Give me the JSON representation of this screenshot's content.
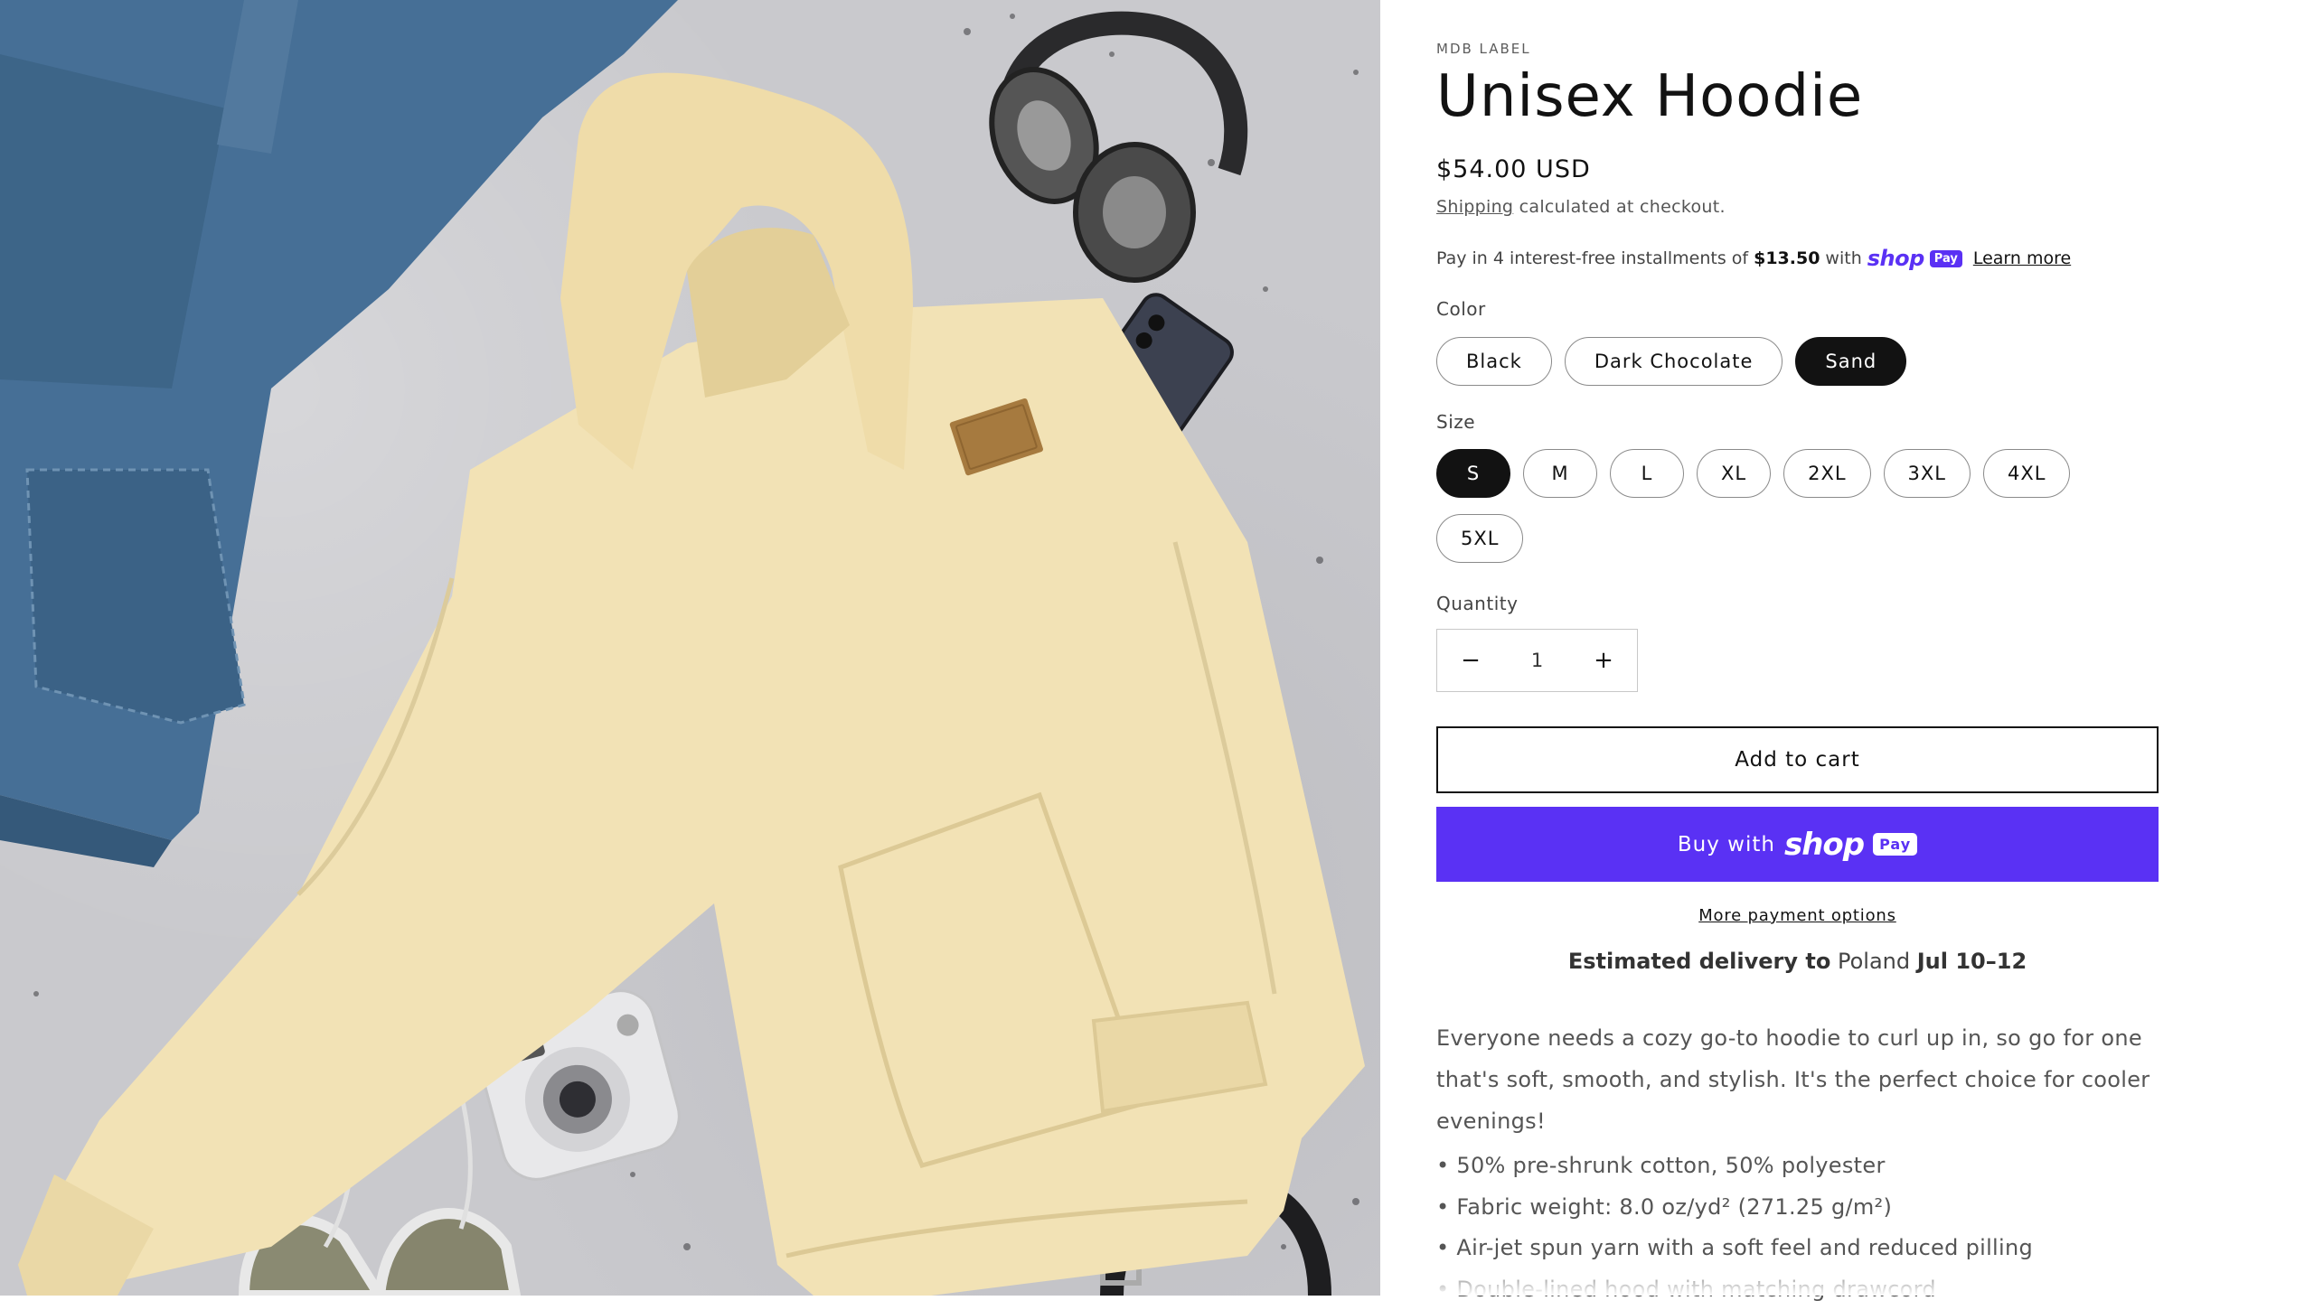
{
  "product": {
    "vendor": "MDB LABEL",
    "title": "Unisex Hoodie",
    "price": "$54.00 USD",
    "shipping_link": "Shipping",
    "shipping_rest": "calculated at checkout."
  },
  "installments": {
    "prefix": "Pay in 4 interest-free installments of",
    "amount": "$13.50",
    "with": "with",
    "shop": "shop",
    "pay": "Pay",
    "learn_more": "Learn more"
  },
  "color": {
    "label": "Color",
    "options": [
      "Black",
      "Dark Chocolate",
      "Sand"
    ],
    "selected": "Sand"
  },
  "size": {
    "label": "Size",
    "options": [
      "S",
      "M",
      "L",
      "XL",
      "2XL",
      "3XL",
      "4XL",
      "5XL"
    ],
    "selected": "S"
  },
  "quantity": {
    "label": "Quantity",
    "value": "1",
    "minus": "−",
    "plus": "+"
  },
  "buttons": {
    "add_to_cart": "Add to cart",
    "buy_with": "Buy with",
    "shop": "shop",
    "pay": "Pay",
    "more_payment": "More payment options"
  },
  "delivery": {
    "lead": "Estimated delivery to",
    "country": "Poland",
    "dates": "Jul 10–12"
  },
  "description": {
    "text": "Everyone needs a cozy go-to hoodie to curl up in, so go for one that's soft, smooth, and stylish. It's the perfect choice for cooler evenings!",
    "bullets": [
      "• 50% pre-shrunk cotton, 50% polyester",
      "• Fabric weight: 8.0 oz/yd² (271.25 g/m²)",
      "• Air-jet spun yarn with a soft feel and reduced pilling",
      "• Double-lined hood with matching drawcord"
    ]
  },
  "colors": {
    "shop_purple": "#5a31f4",
    "selected_pill": "#121212",
    "hoodie": "#f2e2b5"
  },
  "image": {
    "alt_icon": "product-photo-hoodie"
  }
}
